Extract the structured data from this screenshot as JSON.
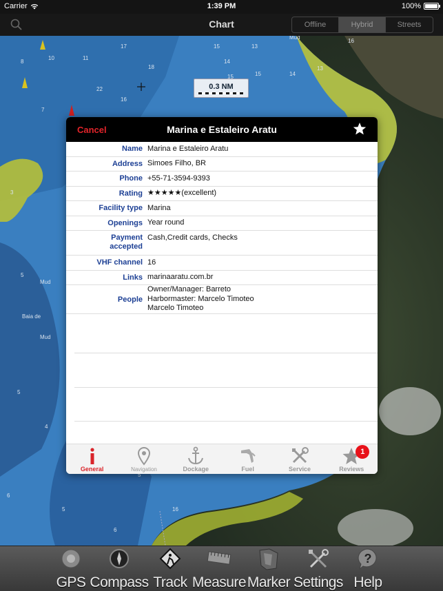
{
  "status_bar": {
    "carrier": "Carrier",
    "time": "1:39 PM",
    "battery": "100%"
  },
  "nav": {
    "title": "Chart",
    "segments": [
      {
        "label": "Offline"
      },
      {
        "label": "Hybrid",
        "active": true
      },
      {
        "label": "Streets"
      }
    ]
  },
  "map": {
    "scale": "0.3 NM"
  },
  "dialog": {
    "cancel": "Cancel",
    "title": "Marina e Estaleiro Aratu",
    "rows": [
      {
        "label": "Name",
        "value": "Marina e Estaleiro Aratu"
      },
      {
        "label": "Address",
        "value": "Simoes Filho, BR"
      },
      {
        "label": "Phone",
        "value": "+55-71-3594-9393"
      },
      {
        "label": "Rating",
        "value": "★★★★★(excellent)"
      },
      {
        "label": "Facility type",
        "value": "Marina"
      },
      {
        "label": "Openings",
        "value": "Year round"
      },
      {
        "label": "Payment",
        "label2": "accepted",
        "value": "Cash,Credit cards, Checks"
      },
      {
        "label": "VHF channel",
        "value": "16"
      },
      {
        "label": "Links",
        "value": "marinaaratu.com.br"
      },
      {
        "label": "People",
        "values": [
          "Owner/Manager: Barreto",
          "Harbormaster: Marcelo Timoteo",
          "Marcelo Timoteo"
        ]
      }
    ],
    "tabs": [
      {
        "label": "General",
        "icon": "info-icon",
        "active": true
      },
      {
        "label": "Navigation",
        "icon": "location-pin-icon"
      },
      {
        "label": "Dockage",
        "icon": "anchor-icon"
      },
      {
        "label": "Fuel",
        "icon": "fuel-nozzle-icon"
      },
      {
        "label": "Service",
        "icon": "tools-icon"
      },
      {
        "label": "Reviews",
        "icon": "star-icon",
        "badge": "1"
      }
    ]
  },
  "toolbar": [
    {
      "label": "GPS",
      "icon": "gps-icon"
    },
    {
      "label": "Compass",
      "icon": "compass-icon"
    },
    {
      "label": "Track",
      "icon": "track-icon"
    },
    {
      "label": "Measure",
      "icon": "ruler-icon"
    },
    {
      "label": "Marker",
      "icon": "marker-icon"
    },
    {
      "label": "Settings",
      "icon": "settings-icon"
    },
    {
      "label": "Help",
      "icon": "help-icon"
    }
  ],
  "colors": {
    "accent_red": "#e2242a",
    "label_blue": "#1c3f94",
    "badge_red": "#e8121a"
  }
}
